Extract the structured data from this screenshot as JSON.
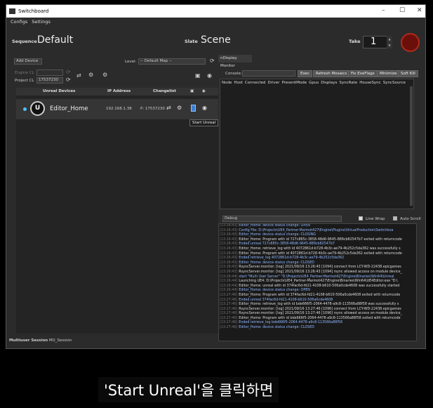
{
  "window": {
    "title": "Switchboard"
  },
  "menu": [
    "Configs",
    "Settings"
  ],
  "top": {
    "sequence_label": "Sequence",
    "sequence_value": "Default",
    "slate_label": "Slate",
    "slate_value": "Scene",
    "take_label": "Take",
    "take_value": "1"
  },
  "left": {
    "add_device": "Add Device",
    "level_label": "Level:",
    "level_value": "-- Default Map --",
    "engine_cl_label": "Engine CL",
    "project_cl_label": "Project CL",
    "project_cl_value": "17537230",
    "headers": {
      "devices": "Unreal Devices",
      "ip": "IP Address",
      "changelist": "Changelist"
    },
    "device": {
      "name": "Editor_Home",
      "ip": "192.168.1.38",
      "changelist": "P: 17537230"
    },
    "tooltip": "Start Unreal",
    "session_label": "Multiuser Session",
    "session_value": "MU_Session"
  },
  "right": {
    "tab": "nDisplay Monitor",
    "console_label": "Console:",
    "buttons": [
      "Exec",
      "Refresh Mosaics",
      "Fix ExeFlags",
      "Minimize",
      "Soft Kill"
    ],
    "columns": [
      "Node",
      "Host",
      "Connected",
      "Driver",
      "PresentMode",
      "Gpus",
      "Displays",
      "SyncRate",
      "HouseSync",
      "SyncSource"
    ],
    "log_level": "Debug",
    "line_wrap": "Line Wrap",
    "auto_scroll": "Auto Scroll"
  },
  "log": [
    {
      "ts": "[13:26:43]",
      "text": "Editor_Home: device status change: OPEN",
      "color": "#8fb8ff"
    },
    {
      "ts": "[13:26:43]",
      "text": "Config File: D:\\Projects\\UE4_Partner-Marmot427\\Engine\\Plugins\\VirtualProduction\\Switchboa",
      "color": "#8fb8ff"
    },
    {
      "ts": "[13:26:43]",
      "text": "Editor_Home: device status change: CLOSING",
      "color": "#8fb8ff"
    },
    {
      "ts": "[13:26:43]",
      "text": "Editor_Home: Program with id 727c885c-3858-48d6-9645-889cb82547b7 exited with returncode",
      "color": "#dddddd"
    },
    {
      "ts": "[13:26:43]",
      "text": "Ended unreal 727c885c-3858-48d6-9645-889cb82547b7",
      "color": "#8fb8ff"
    },
    {
      "ts": "[13:26:43]",
      "text": "Editor_Home: retrieve_log with id 4072861d-b728-4b3c-ae79-4b252c5da362 was successfully s",
      "color": "#dddddd"
    },
    {
      "ts": "[13:26:43]",
      "text": "Editor_Home: Program with id 4072861d-b728-4b3c-ae79-4b252c5da362 exited with returncode",
      "color": "#dddddd"
    },
    {
      "ts": "[13:26:43]",
      "text": "Ended retrieve_log 4072861d-b728-4b3c-ae79-4b252c5da362",
      "color": "#8fb8ff"
    },
    {
      "ts": "[13:26:43]",
      "text": "Editor_Home: device status change: CLOSED",
      "color": "#8fb8ff"
    },
    {
      "ts": "[13:26:43]",
      "text": "RsyncServer.monitor: [log] 2021/09/16 13:26:43 [1094] connect from LCY-WD-22438.epicgames",
      "color": "#dddddd"
    },
    {
      "ts": "[13:26:43]",
      "text": "RsyncServer.monitor: [log] 2021/09/16 13:26:43 [1094] rsync allowed access on module device_",
      "color": "#dddddd"
    },
    {
      "ts": "[13:26:44]",
      "text": "start \"Multi User Server\" \"D:\\Projects\\UE4_Partner-Marmot427\\Engine\\Binaries\\Win64\\Unreal",
      "color": "#8fb8ff"
    },
    {
      "ts": "[13:26:44]",
      "text": "Launching UE4: D:\\Projects\\UE4_Partner-Marmot427\\Engine\\Binaries\\Win64\\UE4Editor.exe \"D:\\",
      "color": "#dddddd"
    },
    {
      "ts": "[13:26:44]",
      "text": "Editor_Home: unreal with id 374fac6d-fd21-4108-b610-506a0cde4608 was successfully started",
      "color": "#dddddd"
    },
    {
      "ts": "[13:26:44]",
      "text": "Editor_Home: device status change: OPEN",
      "color": "#8fb8ff"
    },
    {
      "ts": "[13:27:46]",
      "text": "Editor_Home: Program with id 374fac6d-fd21-4108-b610-506a0cde4608 exited with returncode",
      "color": "#dddddd"
    },
    {
      "ts": "[13:27:46]",
      "text": "Ended unreal 374fac6d-fd21-4108-b610-506a0cde4608",
      "color": "#8fb8ff"
    },
    {
      "ts": "[13:27:46]",
      "text": "Editor_Home: retrieve_log with id bde666f5-2064-4478-a9c8-113566a88f58 was successfully s",
      "color": "#dddddd"
    },
    {
      "ts": "[13:27:46]",
      "text": "RsyncServer.monitor: [log] 2021/09/16 13:27:46 [1096] connect from LCY-WD-22438.epicgames",
      "color": "#dddddd"
    },
    {
      "ts": "[13:27:46]",
      "text": "RsyncServer.monitor: [log] 2021/09/16 13:27:46 [1096] rsync allowed access on module device_",
      "color": "#dddddd"
    },
    {
      "ts": "[13:27:46]",
      "text": "Editor_Home: Program with id bde666f5-2064-4478-a9c8-113566a88f58 exited with returncode",
      "color": "#dddddd"
    },
    {
      "ts": "[13:27:46]",
      "text": "Ended retrieve_log bde666f5-2064-4478-a9c8-113566a88f58",
      "color": "#8fb8ff"
    },
    {
      "ts": "[13:27:46]",
      "text": "Editor_Home: device status change: CLOSED",
      "color": "#8fb8ff"
    }
  ],
  "caption": "'Start Unreal'을 클릭하면"
}
